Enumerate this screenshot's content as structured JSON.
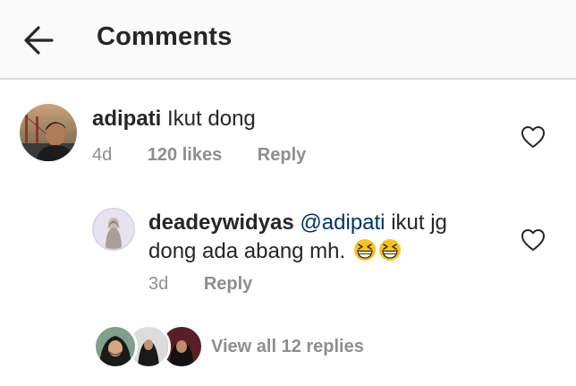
{
  "header": {
    "title": "Comments",
    "back_icon": "arrow-left-icon"
  },
  "comments": [
    {
      "username": "adipati",
      "text": "Ikut dong",
      "time": "4d",
      "likes": "120 likes",
      "reply_label": "Reply",
      "like_icon": "heart-outline-icon"
    }
  ],
  "reply": {
    "username": "deadeywidyas",
    "mention": "@adipati",
    "text_line1": "ikut jg",
    "text_line2": "dong ada abang mh.",
    "emojis": [
      "grinning-squinting-face-emoji",
      "grinning-squinting-face-emoji"
    ],
    "time": "3d",
    "reply_label": "Reply",
    "like_icon": "heart-outline-icon"
  },
  "view_replies": {
    "label": "View all 12 replies"
  },
  "colors": {
    "text": "#262626",
    "secondary": "#8e8e8e",
    "mention": "#003569",
    "header_bg": "#fafafa",
    "divider": "#dbdbdb"
  }
}
